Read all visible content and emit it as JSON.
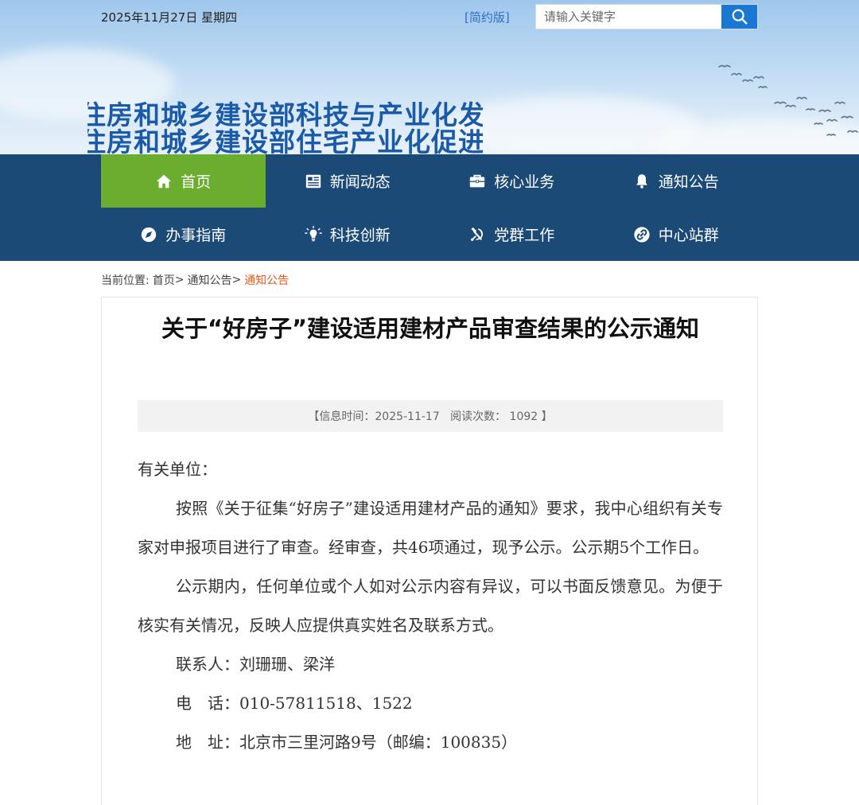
{
  "header": {
    "date": "2025年11月27日 星期四",
    "simple_version": "[简约版]",
    "search_placeholder": "请输入关键字",
    "site_title_line1": "住房和城乡建设部科技与产业化发展中心",
    "site_title_line2": "住房和城乡建设部住宅产业化促进中心",
    "accent_color": "#1a77d2"
  },
  "nav": {
    "items": [
      {
        "label": "首页",
        "icon": "home-icon"
      },
      {
        "label": "新闻动态",
        "icon": "newspaper-icon"
      },
      {
        "label": "核心业务",
        "icon": "briefcase-icon"
      },
      {
        "label": "通知公告",
        "icon": "bell-icon"
      },
      {
        "label": "办事指南",
        "icon": "compass-icon"
      },
      {
        "label": "科技创新",
        "icon": "lightbulb-icon"
      },
      {
        "label": "党群工作",
        "icon": "hammer-sickle-icon"
      },
      {
        "label": "中心站群",
        "icon": "link-icon"
      }
    ],
    "active_color": "#6aad2f",
    "background_color": "#1c4a76"
  },
  "breadcrumb": {
    "prefix": "当前位置:",
    "home": "首页",
    "sep1": ">",
    "section": "通知公告",
    "sep2": ">",
    "current": "通知公告"
  },
  "article": {
    "title": "关于“好房子”建设适用建材产品审查结果的公示通知",
    "meta": "【信息时间：2025-11-17   阅读次数： 1092 】",
    "salutation": "有关单位：",
    "para1": "按照《关于征集“好房子”建设适用建材产品的通知》要求，我中心组织有关专家对申报项目进行了审查。经审查，共46项通过，现予公示。公示期5个工作日。",
    "para2": "公示期内，任何单位或个人如对公示内容有异议，可以书面反馈意见。为便于核实有关情况，反映人应提供真实姓名及联系方式。",
    "contact": "联系人：刘珊珊、梁洋",
    "phone": "电　话：010-57811518、1522",
    "address": "地　址：北京市三里河路9号（邮编：100835）"
  }
}
